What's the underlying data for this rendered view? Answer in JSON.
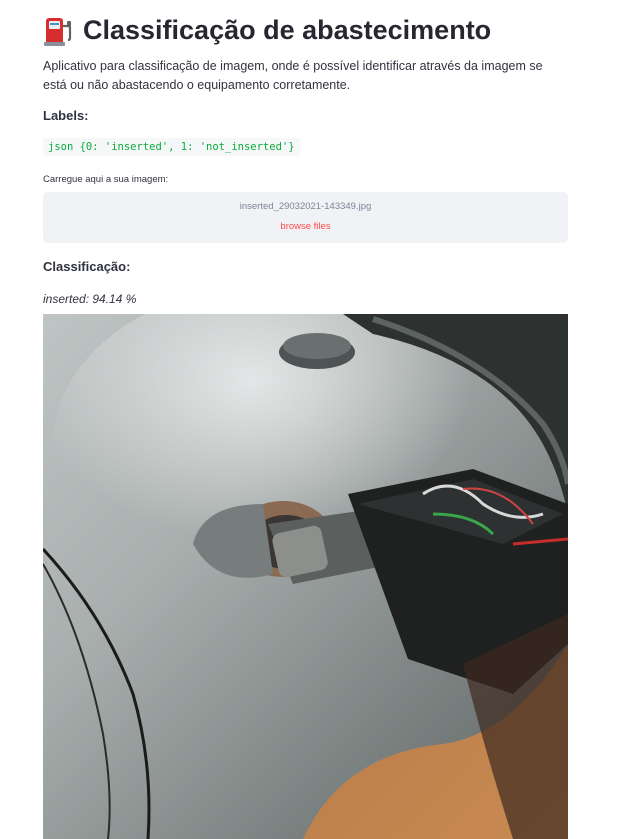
{
  "header": {
    "icon": "fuel-pump-icon",
    "title": "Classificação de abastecimento"
  },
  "description": "Aplicativo para classificação de imagem, onde é possível identificar através da imagem se está ou não abastacendo o equipamento corretamente.",
  "labels_section": {
    "heading": "Labels:",
    "code": "json {0: 'inserted', 1: 'not_inserted'}"
  },
  "uploader": {
    "label": "Carregue aqui a sua imagem:",
    "file_name": "inserted_29032021-143349.jpg",
    "browse_label": "browse files"
  },
  "classification": {
    "heading": "Classificação:",
    "result": "inserted: 94.14 %"
  },
  "image": {
    "description_icon": "photo-fuel-nozzle-inserted"
  },
  "colors": {
    "code_text": "#09ab3b",
    "browse_link": "#ff4b4b",
    "uploader_bg": "#f0f2f6",
    "title_text": "#262730"
  }
}
